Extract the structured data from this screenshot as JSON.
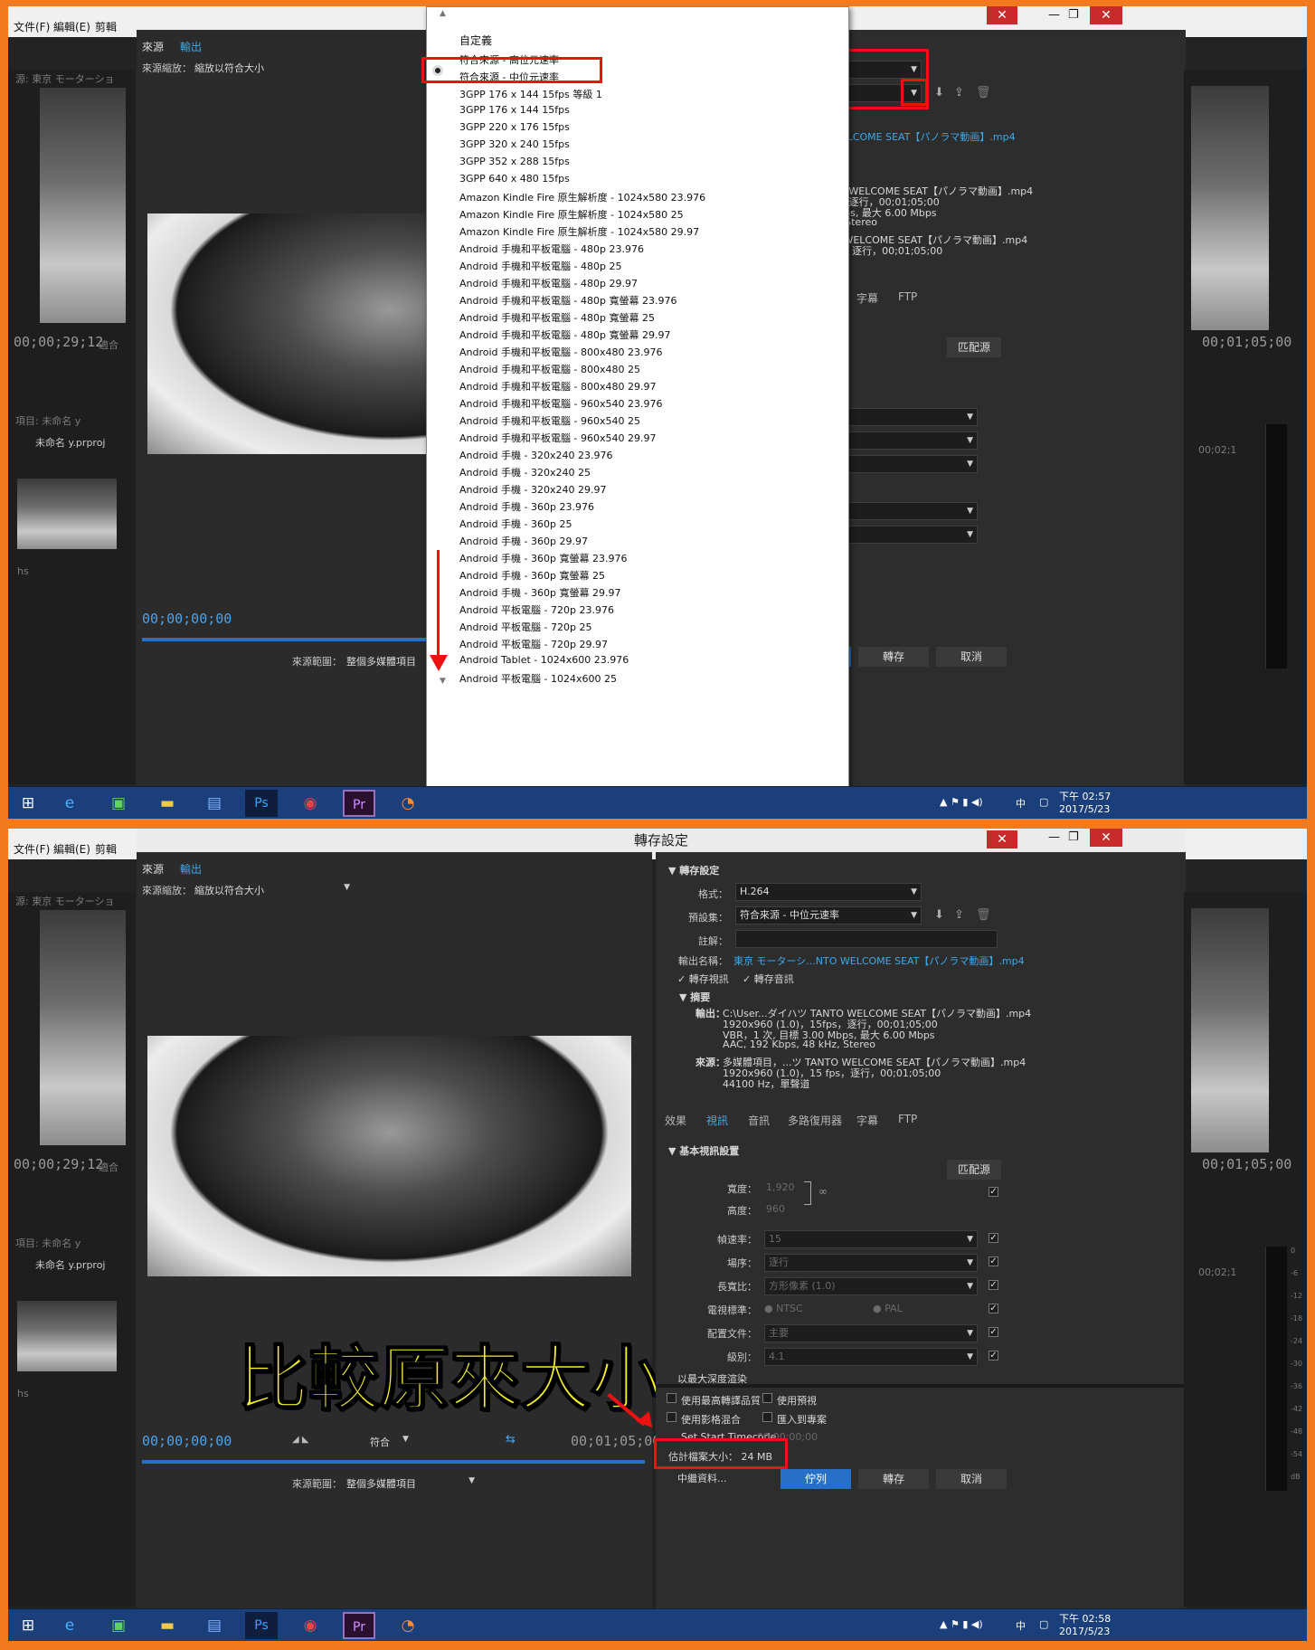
{
  "menubar": {
    "file": "文件(F)",
    "edit": "編輯(E)",
    "clip": "剪輯"
  },
  "source_panel": {
    "tab_source": "來源",
    "tab_output": "輸出",
    "scale_label": "來源縮放：",
    "scale_value": "縮放以符合大小",
    "range_label": "來源範圍：",
    "range_value": "整個多媒體項目",
    "fit_label": "符合"
  },
  "background": {
    "source_label": "源: 東京 モーターショ",
    "timecode_left": "00;00;29;12",
    "fit_short": "適合",
    "timecode_right": "00;01;05;00",
    "timecode_playhead": "00;00;00;00",
    "timecode_end": "00;01;05;00",
    "project_title": "項目: 未命名 y",
    "project_file": "未命名 y.prproj",
    "clip_name": "hs",
    "timeline_tc": "00;02;1"
  },
  "meter_scale": [
    "0",
    "-6",
    "-12",
    "-18",
    "-24",
    "-30",
    "-36",
    "-42",
    "-48",
    "-54",
    "dB"
  ],
  "dialog": {
    "title": "轉存設定"
  },
  "export": {
    "section_title": "轉存設定",
    "format_label": "格式：",
    "format_value": "H.264",
    "preset_label": "預設集：",
    "preset_value": "符合來源 - 中位元速率",
    "comment_label": "註解：",
    "output_name_label": "輸出名稱：",
    "output_name_value": "東京 モーターシ...NTO WELCOME SEAT【パノラマ動画】.mp4",
    "export_video": "轉存視訊",
    "export_audio": "轉存音訊",
    "summary_title": "摘要",
    "summary_output_label": "輸出：",
    "summary_output_lines": [
      "C:\\User...ダイハツ TANTO WELCOME SEAT【パノラマ動画】.mp4",
      "1920x960 (1.0)，15fps，逐行，00;01;05;00",
      "VBR，1 次, 目標 3.00 Mbps, 最大 6.00 Mbps",
      "AAC, 192 Kbps, 48 kHz, Stereo"
    ],
    "summary_source_label": "來源：",
    "summary_source_lines": [
      "多媒體項目，...ツ TANTO WELCOME SEAT【パノラマ動画】.mp4",
      "1920x960 (1.0)，15 fps，逐行，00;01;05;00",
      "44100 Hz，單聲道"
    ],
    "tabs": [
      "效果",
      "視訊",
      "音訊",
      "多路復用器",
      "字幕",
      "FTP"
    ],
    "basic_video_title": "基本視訊設置",
    "match_source_button": "匹配源",
    "width_label": "寬度：",
    "width_value": "1,920",
    "height_label": "高度：",
    "height_value": "960",
    "framerate_label": "幀速率：",
    "framerate_value": "15",
    "field_label": "場序：",
    "field_value": "逐行",
    "aspect_label": "長寬比：",
    "aspect_value": "方形像素 (1.0)",
    "tvstd_label": "電視標準：",
    "tvstd_ntsc": "NTSC",
    "tvstd_pal": "PAL",
    "profile_label": "配置文件：",
    "profile_value": "主要",
    "level_label": "級別：",
    "level_value": "4.1",
    "max_depth": "以最大深度渲染",
    "max_quality": "使用最高轉譯品質",
    "use_preview": "使用預視",
    "use_blend": "使用影格混合",
    "import_project": "匯入到專案",
    "timecode_label": "Set Start Timecode",
    "timecode_value": "00;00;00;00",
    "filesize_label": "估計檔案大小：",
    "filesize_value": "24 MB",
    "metadata_button": "中繼資料...",
    "queue_button": "佇列",
    "export_button": "轉存",
    "cancel_button": "取消"
  },
  "preset_dropdown": {
    "header": "自定義",
    "items": [
      "符合來源 - 高位元速率",
      "符合來源 - 中位元速率",
      "3GPP 176 x 144 15fps 等級 1",
      "3GPP 176 x 144 15fps",
      "3GPP 220 x 176 15fps",
      "3GPP 320 x 240 15fps",
      "3GPP 352 x 288 15fps",
      "3GPP 640 x 480 15fps",
      "Amazon Kindle Fire 原生解析度 - 1024x580 23.976",
      "Amazon Kindle Fire 原生解析度 - 1024x580 25",
      "Amazon Kindle Fire 原生解析度 - 1024x580 29.97",
      "Android 手機和平板電腦 - 480p 23.976",
      "Android 手機和平板電腦 - 480p 25",
      "Android 手機和平板電腦 - 480p 29.97",
      "Android 手機和平板電腦 - 480p 寬螢幕 23.976",
      "Android 手機和平板電腦 - 480p 寬螢幕 25",
      "Android 手機和平板電腦 - 480p 寬螢幕 29.97",
      "Android 手機和平板電腦 - 800x480 23.976",
      "Android 手機和平板電腦 - 800x480 25",
      "Android 手機和平板電腦 - 800x480 29.97",
      "Android 手機和平板電腦 - 960x540 23.976",
      "Android 手機和平板電腦 - 960x540 25",
      "Android 手機和平板電腦 - 960x540 29.97",
      "Android 手機 - 320x240 23.976",
      "Android 手機 - 320x240 25",
      "Android 手機 - 320x240 29.97",
      "Android 手機 - 360p 23.976",
      "Android 手機 - 360p 25",
      "Android 手機 - 360p 29.97",
      "Android 手機 - 360p 寬螢幕 23.976",
      "Android 手機 - 360p 寬螢幕 25",
      "Android 手機 - 360p 寬螢幕 29.97",
      "Android 平板電腦 - 720p 23.976",
      "Android 平板電腦 - 720p 25",
      "Android 平板電腦 - 720p 29.97",
      "Android Tablet - 1024x600 23.976",
      "Android 平板電腦 - 1024x600 25"
    ]
  },
  "overlay_text": "比較原來大小",
  "taskbar": {
    "lang": "中",
    "time1": "下午 02:57",
    "time2": "下午 02:58",
    "date": "2017/5/23",
    "ps_label": "Ps",
    "pr_label": "Pr"
  },
  "colors": {
    "accent": "#2670c9",
    "annotation": "#e11111",
    "overlay": "#f4ef28",
    "frame": "#f47a20"
  }
}
